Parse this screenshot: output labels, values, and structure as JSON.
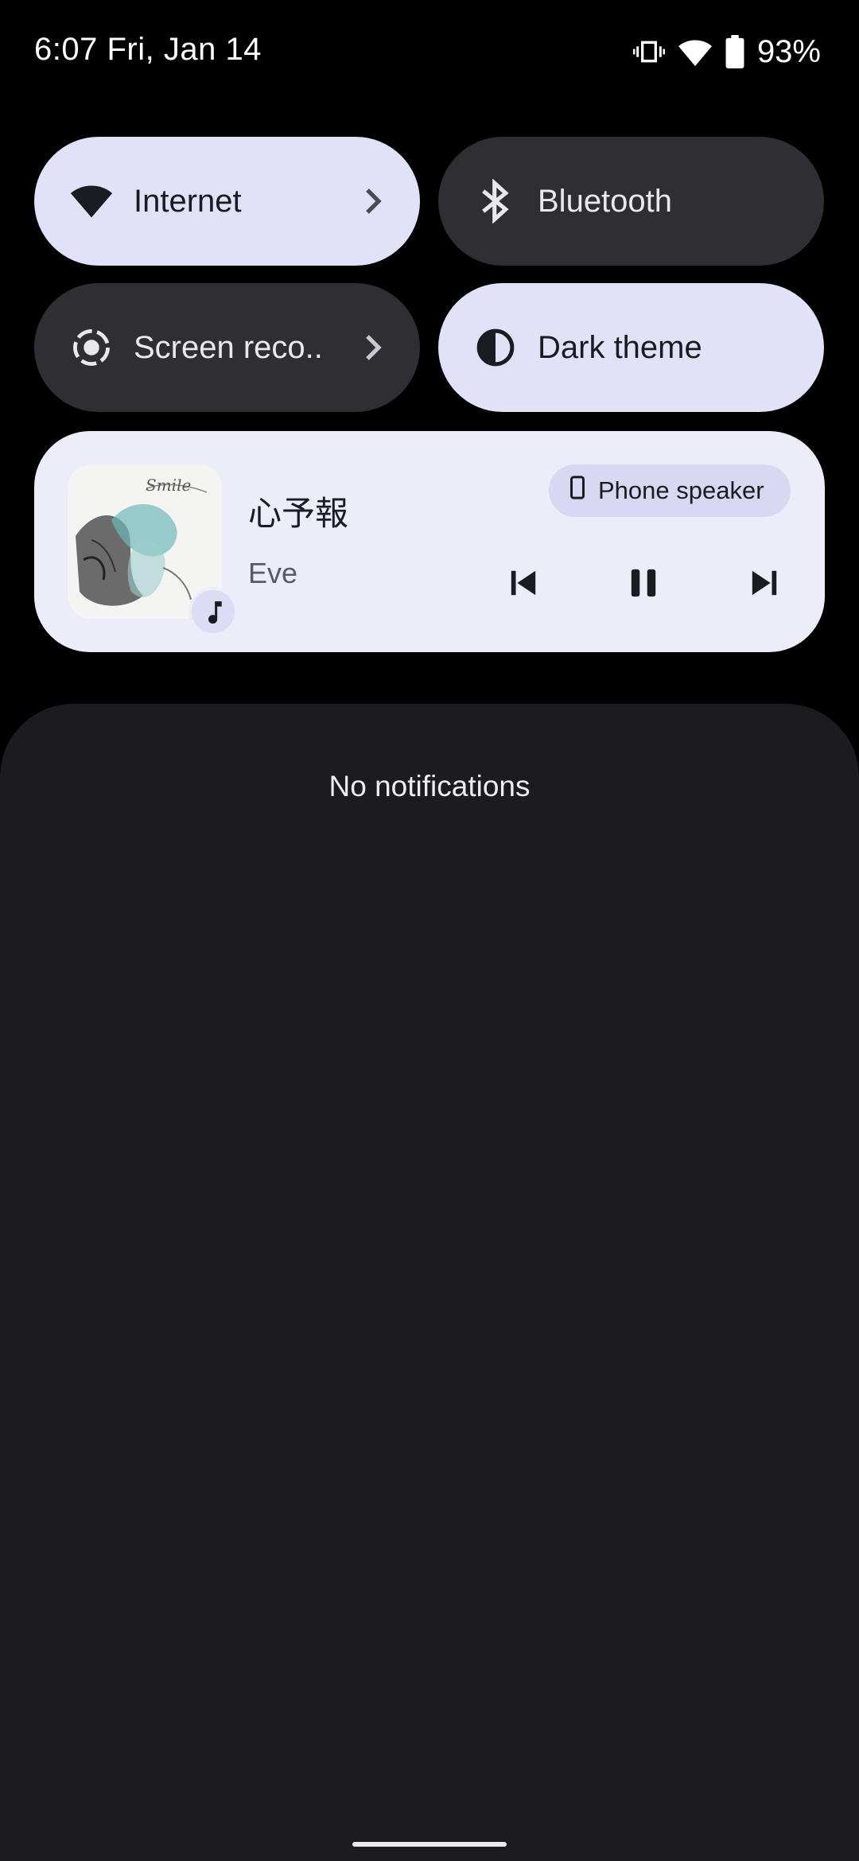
{
  "status_bar": {
    "time": "6:07 Fri, Jan 14",
    "battery": "93%",
    "icons": [
      "vibrate-icon",
      "wifi-icon",
      "battery-icon"
    ]
  },
  "quick_settings": {
    "tiles": [
      {
        "label": "Internet",
        "icon": "wifi-icon",
        "state": "on",
        "has_chevron": true
      },
      {
        "label": "Bluetooth",
        "icon": "bluetooth-icon",
        "state": "off",
        "has_chevron": false
      },
      {
        "label": "Screen reco..",
        "icon": "screen-record-icon",
        "state": "off",
        "has_chevron": true
      },
      {
        "label": "Dark theme",
        "icon": "dark-theme-icon",
        "state": "on",
        "has_chevron": false
      }
    ]
  },
  "media": {
    "title": "心予報",
    "artist": "Eve",
    "output_device": "Phone speaker",
    "album_art_text": "Smile",
    "controls": [
      "skip-previous-icon",
      "pause-icon",
      "skip-next-icon"
    ]
  },
  "notifications": {
    "empty_text": "No notifications"
  },
  "colors": {
    "tile_on": "#e1e1f8",
    "tile_off": "#2e2e33",
    "media_card": "#ededfa",
    "panel": "#1c1b20"
  }
}
